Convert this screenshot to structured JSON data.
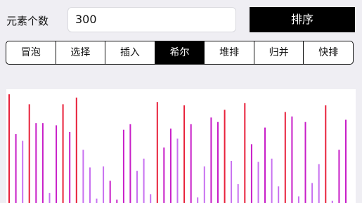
{
  "count": {
    "label": "元素个数",
    "value": "300"
  },
  "sort_button": {
    "label": "排序"
  },
  "algorithms": [
    {
      "label": "冒泡",
      "active": false
    },
    {
      "label": "选择",
      "active": false
    },
    {
      "label": "插入",
      "active": false
    },
    {
      "label": "希尔",
      "active": true
    },
    {
      "label": "堆排",
      "active": false
    },
    {
      "label": "归并",
      "active": false
    },
    {
      "label": "快排",
      "active": false
    }
  ],
  "colors": {
    "high": "#e8203a",
    "mid": "#c81ec8",
    "low": "#c870f0"
  },
  "bars": [
    {
      "v": 0.98,
      "c": "high"
    },
    {
      "v": 0.62,
      "c": "mid"
    },
    {
      "v": 0.56,
      "c": "low"
    },
    {
      "v": 0.89,
      "c": "high"
    },
    {
      "v": 0.72,
      "c": "mid"
    },
    {
      "v": 0.72,
      "c": "mid"
    },
    {
      "v": 0.09,
      "c": "low"
    },
    {
      "v": 0.7,
      "c": "mid"
    },
    {
      "v": 0.89,
      "c": "high"
    },
    {
      "v": 0.64,
      "c": "mid"
    },
    {
      "v": 0.95,
      "c": "high"
    },
    {
      "v": 0.48,
      "c": "low"
    },
    {
      "v": 0.32,
      "c": "low"
    },
    {
      "v": 0.04,
      "c": "low"
    },
    {
      "v": 0.33,
      "c": "low"
    },
    {
      "v": 0.2,
      "c": "mid"
    },
    {
      "v": 0.03,
      "c": "mid"
    },
    {
      "v": 0.66,
      "c": "mid"
    },
    {
      "v": 0.71,
      "c": "mid"
    },
    {
      "v": 0.29,
      "c": "low"
    },
    {
      "v": 0.4,
      "c": "low"
    },
    {
      "v": 0.08,
      "c": "low"
    },
    {
      "v": 0.91,
      "c": "high"
    },
    {
      "v": 0.5,
      "c": "mid"
    },
    {
      "v": 0.67,
      "c": "mid"
    },
    {
      "v": 0.58,
      "c": "low"
    },
    {
      "v": 0.88,
      "c": "high"
    },
    {
      "v": 0.71,
      "c": "mid"
    },
    {
      "v": 0.05,
      "c": "low"
    },
    {
      "v": 0.33,
      "c": "low"
    },
    {
      "v": 0.77,
      "c": "mid"
    },
    {
      "v": 0.73,
      "c": "mid"
    },
    {
      "v": 0.84,
      "c": "high"
    },
    {
      "v": 0.38,
      "c": "low"
    },
    {
      "v": 0.17,
      "c": "low"
    },
    {
      "v": 0.9,
      "c": "high"
    },
    {
      "v": 0.53,
      "c": "mid"
    },
    {
      "v": 0.37,
      "c": "low"
    },
    {
      "v": 0.68,
      "c": "mid"
    },
    {
      "v": 0.4,
      "c": "low"
    },
    {
      "v": 0.15,
      "c": "low"
    },
    {
      "v": 0.82,
      "c": "high"
    },
    {
      "v": 0.78,
      "c": "mid"
    },
    {
      "v": 0.06,
      "c": "low"
    },
    {
      "v": 0.73,
      "c": "mid"
    },
    {
      "v": 0.18,
      "c": "low"
    },
    {
      "v": 0.35,
      "c": "low"
    },
    {
      "v": 0.88,
      "c": "high"
    },
    {
      "v": 0.02,
      "c": "low"
    },
    {
      "v": 0.48,
      "c": "mid"
    },
    {
      "v": 0.75,
      "c": "mid"
    }
  ]
}
